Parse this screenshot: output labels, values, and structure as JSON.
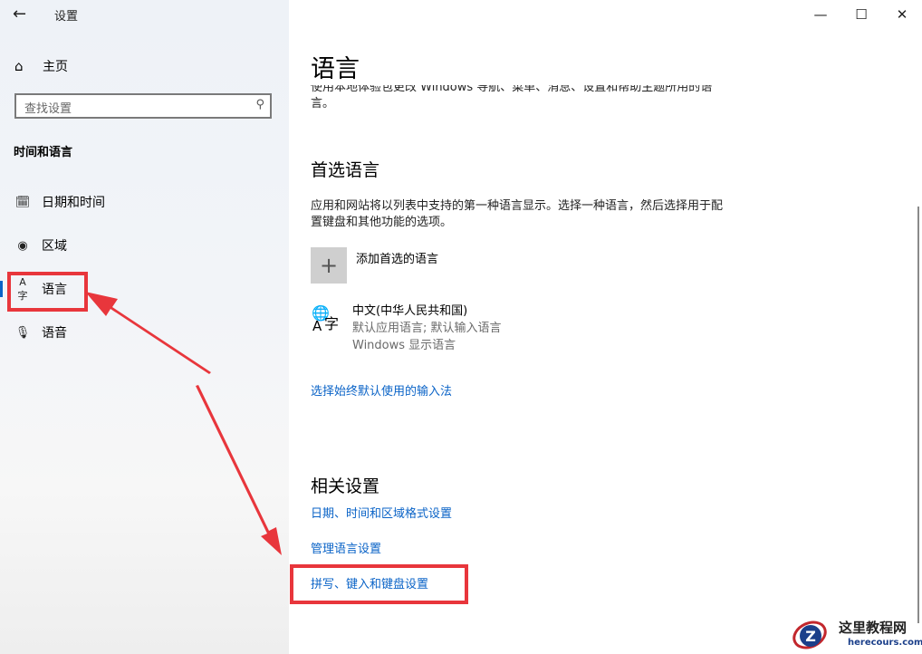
{
  "window": {
    "title": "设置",
    "controls": {
      "minimize": "—",
      "maximize": "☐",
      "close": "✕"
    }
  },
  "sidebar": {
    "back_icon": "back-arrow-icon",
    "home": {
      "label": "主页",
      "icon": "home-icon"
    },
    "search": {
      "placeholder": "查找设置",
      "icon": "search-icon"
    },
    "section_title": "时间和语言",
    "items": [
      {
        "label": "日期和时间",
        "icon": "calendar-clock-icon",
        "selected": false
      },
      {
        "label": "区域",
        "icon": "globe-region-icon",
        "selected": false
      },
      {
        "label": "语言",
        "icon": "language-icon",
        "selected": true
      },
      {
        "label": "语音",
        "icon": "microphone-icon",
        "selected": false
      }
    ]
  },
  "main": {
    "title": "语言",
    "intro": "使用本地体验包更改 Windows 导航、菜单、消息、设置和帮助主题所用的语言。",
    "preferred": {
      "heading": "首选语言",
      "description": "应用和网站将以列表中支持的第一种语言显示。选择一种语言，然后选择用于配置键盘和其他功能的选项。",
      "add_label": "添加首选的语言",
      "add_icon": "plus-icon",
      "languages": [
        {
          "name": "中文(中华人民共和国)",
          "line1": "默认应用语言; 默认输入语言",
          "line2": "Windows 显示语言",
          "icon": "language-icon"
        }
      ],
      "input_method_link": "选择始终默认使用的输入法"
    },
    "related": {
      "heading": "相关设置",
      "links": [
        "日期、时间和区域格式设置",
        "管理语言设置",
        "拼写、键入和键盘设置"
      ]
    }
  },
  "annotation_color": "#e8363c",
  "accent_color": "#0a63c7",
  "watermark": {
    "cn": "这里教程网",
    "en": "herecours.com",
    "logo_letter": "Z"
  }
}
